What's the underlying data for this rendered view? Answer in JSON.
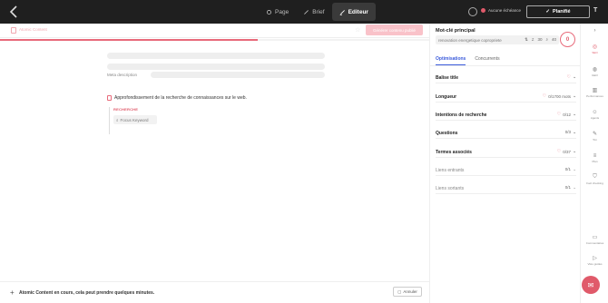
{
  "topbar": {
    "tabs": [
      {
        "label": "Page",
        "icon": "gear-icon"
      },
      {
        "label": "Brief",
        "icon": "pencil-icon"
      },
      {
        "label": "Editeur",
        "icon": "edit-icon"
      }
    ],
    "deadline": "Aucune échéance",
    "planifie": "Planifié",
    "t_label": "T"
  },
  "editor": {
    "title": "Atomic Content",
    "generate_button": "Générer contenu publié",
    "meta_description_label": "Meta description",
    "task_text": "Approfondissement de la recherche de connaissances sur le web.",
    "research_title": "RECHERCHE",
    "focus_keyword": "Focus Keyword",
    "progress": 0.6,
    "footer_text": "Atomic Content en cours, cela peut prendre quelques minutes.",
    "cancel_label": "Annuler",
    "footer_plus": "+"
  },
  "panel": {
    "keyword_label": "Mot-clé principal",
    "keyword_value": "renovation energetique copropriete",
    "keyword_volume": "30",
    "keyword_kd": "40",
    "score": "0",
    "tabs": [
      "Optimisations",
      "Concurrents"
    ],
    "rows": [
      {
        "label": "Balise title",
        "value": ""
      },
      {
        "label": "Longueur",
        "value": "0/1700 mots"
      },
      {
        "label": "Intentions de recherche",
        "value": "0/12"
      },
      {
        "label": "Questions",
        "value": "0/3"
      },
      {
        "label": "Termes associés",
        "value": "0/37"
      },
      {
        "label": "Liens entrants",
        "value": "0/1"
      },
      {
        "label": "Liens sortants",
        "value": "0/1"
      }
    ]
  },
  "rail": {
    "items": [
      "SEO",
      "GEO",
      "Performances",
      "Agents",
      "Ton",
      "Plan",
      "Fact checking",
      "Commentaires",
      "Visio guides"
    ]
  },
  "colors": {
    "accent": "#e05a6a",
    "link": "#3b5bdb",
    "topbar": "#1f1f1f"
  }
}
